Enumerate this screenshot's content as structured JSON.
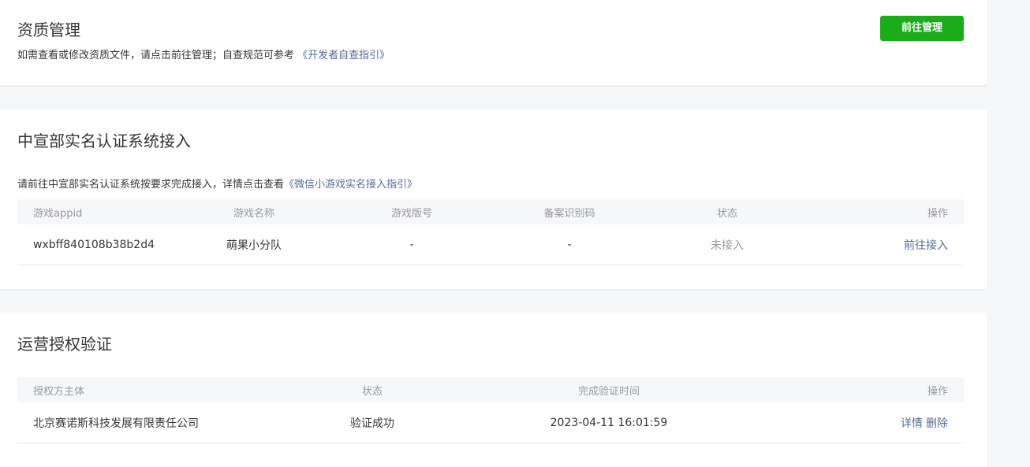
{
  "qualification": {
    "title": "资质管理",
    "desc_text": "如需查看或修改资质文件，请点击前往管理；自查规范可参考 ",
    "desc_link": "《开发者自查指引》",
    "manage_button": "前往管理"
  },
  "realname": {
    "title": "中宣部实名认证系统接入",
    "desc_text": "请前往中宣部实名认证系统按要求完成接入，详情点击查看",
    "desc_link": "《微信小游戏实名接入指引》",
    "columns": [
      "游戏appid",
      "游戏名称",
      "游戏版号",
      "备案识别码",
      "状态",
      "操作"
    ],
    "rows": [
      {
        "appid": "wxbff840108b38b2d4",
        "name": "萌果小分队",
        "license": "-",
        "record_code": "-",
        "status": "未接入",
        "action": "前往接入"
      }
    ]
  },
  "authorization": {
    "title": "运营授权验证",
    "columns": [
      "授权方主体",
      "状态",
      "完成验证时间",
      "操作"
    ],
    "rows": [
      {
        "entity": "北京赛诺斯科技发展有限责任公司",
        "status": "验证成功",
        "time": "2023-04-11 16:01:59",
        "action_detail": "详情",
        "action_delete": "删除"
      }
    ]
  },
  "colors": {
    "primary_green": "#1aad19",
    "link_blue": "#576b95",
    "muted_gray": "#9a9a9a",
    "page_bg": "#f6f7f9"
  }
}
